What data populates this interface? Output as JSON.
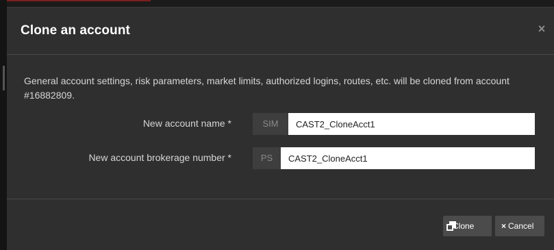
{
  "dialog": {
    "title": "Clone an account",
    "close_symbol": "×",
    "description": "General account settings, risk parameters, market limits, authorized logins, routes, etc. will be cloned from account #16882809."
  },
  "form": {
    "account_name": {
      "label": "New account name  *",
      "prefix": "SIM",
      "value": "CAST2_CloneAcct1"
    },
    "brokerage_number": {
      "label": "New account brokerage number  *",
      "prefix": "PS",
      "value": "CAST2_CloneAcct1"
    }
  },
  "footer": {
    "clone_label": "Clone",
    "cancel_symbol": "×",
    "cancel_label": "Cancel"
  },
  "icons": {
    "close": "close-icon",
    "clone": "clone-icon",
    "cancel": "close-icon"
  },
  "colors": {
    "modal_background": "#2f2f2f",
    "page_background": "#1b1b1b",
    "button_background": "#4b4b4b",
    "addon_background": "#3e3e3e",
    "text": "#d6d6d6",
    "title": "#ffffff"
  }
}
